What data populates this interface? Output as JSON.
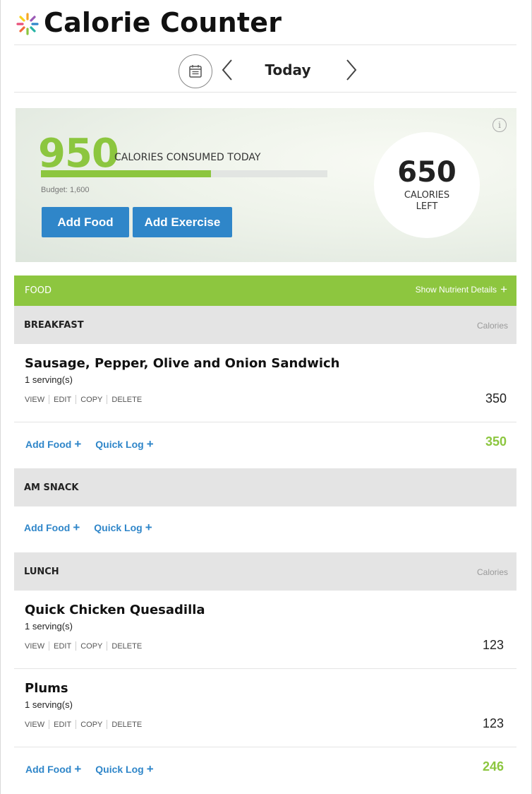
{
  "app": {
    "title": "Calorie Counter",
    "logo_icon": "starburst-logo-icon",
    "colors": {
      "accent_green": "#8cc63f",
      "button_blue": "#2f86c9"
    }
  },
  "date_nav": {
    "label": "Today",
    "calendar_icon": "calendar-icon",
    "prev_icon": "chevron-left-icon",
    "next_icon": "chevron-right-icon"
  },
  "summary": {
    "consumed": "950",
    "consumed_label": "CALORIES CONSUMED TODAY",
    "budget_label": "Budget: 1,600",
    "progress_fraction": 0.594,
    "left_value": "650",
    "left_label_line1": "CALORIES",
    "left_label_line2": "LEFT",
    "add_food_label": "Add Food",
    "add_exercise_label": "Add Exercise",
    "info_icon": "info-icon"
  },
  "food_section": {
    "title": "FOOD",
    "nutrient_link": "Show Nutrient Details",
    "nutrient_plus": "+"
  },
  "meals": [
    {
      "name": "BREAKFAST",
      "calories_header": "Calories",
      "entries": [
        {
          "name": "Sausage, Pepper, Olive and Onion Sandwich",
          "serving": "1 serving(s)",
          "calories": "350"
        }
      ],
      "add_food": "Add Food",
      "quick_log": "Quick Log",
      "total": "350"
    },
    {
      "name": "AM SNACK",
      "calories_header": "",
      "entries": [],
      "add_food": "Add Food",
      "quick_log": "Quick Log",
      "total": ""
    },
    {
      "name": "LUNCH",
      "calories_header": "Calories",
      "entries": [
        {
          "name": "Quick Chicken Quesadilla",
          "serving": "1 serving(s)",
          "calories": "123"
        },
        {
          "name": "Plums",
          "serving": "1 serving(s)",
          "calories": "123"
        }
      ],
      "add_food": "Add Food",
      "quick_log": "Quick Log",
      "total": "246"
    }
  ],
  "entry_actions": {
    "view": "VIEW",
    "edit": "EDIT",
    "copy": "COPY",
    "delete": "DELETE"
  },
  "plus_sign": "+"
}
